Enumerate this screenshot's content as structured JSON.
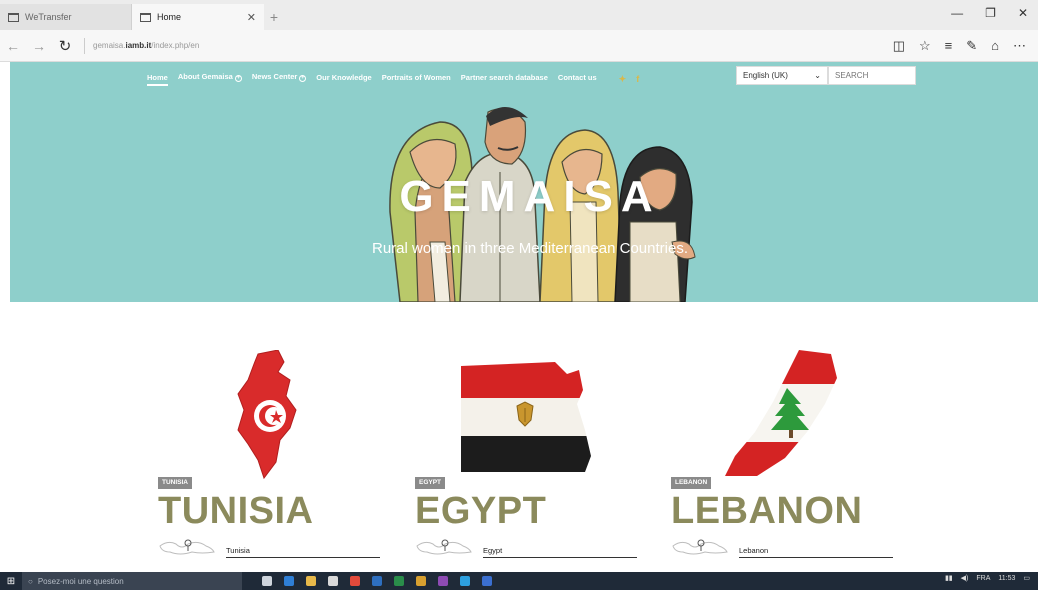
{
  "browser": {
    "tabs": [
      {
        "title": "WeTransfer",
        "active": false
      },
      {
        "title": "Home",
        "active": true
      }
    ],
    "url_prefix": "gemaisa.",
    "url_domain": "iamb.it",
    "url_path": "/index.php/en"
  },
  "site": {
    "nav": [
      {
        "label": "Home",
        "active": true,
        "has_plus": false
      },
      {
        "label": "About Gemaisa",
        "active": false,
        "has_plus": true
      },
      {
        "label": "News Center",
        "active": false,
        "has_plus": true
      },
      {
        "label": "Our Knowledge",
        "active": false,
        "has_plus": false
      },
      {
        "label": "Portraits of Women",
        "active": false,
        "has_plus": false
      },
      {
        "label": "Partner search database",
        "active": false,
        "has_plus": false
      },
      {
        "label": "Contact us",
        "active": false,
        "has_plus": false
      }
    ],
    "language": "English (UK)",
    "search_placeholder": "SEARCH",
    "hero_title": "GEMAISA",
    "hero_subtitle": "Rural women in three Mediterranean Countries.",
    "accent_color": "#8ecfcb",
    "country_color": "#8b8a5c"
  },
  "countries": [
    {
      "badge": "TUNISIA",
      "name": "TUNISIA",
      "link": "Tunisia"
    },
    {
      "badge": "EGYPT",
      "name": "EGYPT",
      "link": "Egypt"
    },
    {
      "badge": "LEBANON",
      "name": "LEBANON",
      "link": "Lebanon"
    }
  ],
  "taskbar": {
    "search_placeholder": "Posez-moi une question",
    "lang": "FRA",
    "time": "11:53"
  }
}
